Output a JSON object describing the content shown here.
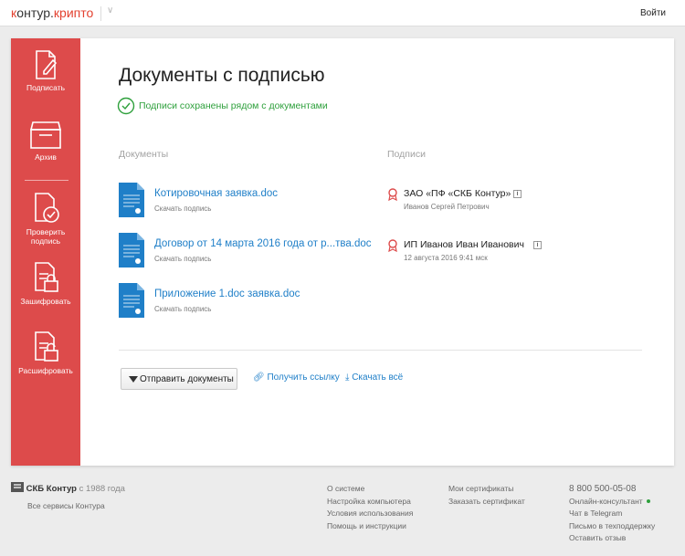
{
  "header": {
    "logo_k": "к",
    "logo_rest": "онтур.",
    "logo_product": "крипто",
    "login_label": "Войти"
  },
  "sidebar": {
    "items": [
      {
        "label": "Подписать",
        "icon": "sign-document-icon"
      },
      {
        "label": "Архив",
        "icon": "archive-icon"
      },
      {
        "label": "Проверить подпись",
        "icon": "verify-signature-icon"
      },
      {
        "label": "Зашифровать",
        "icon": "encrypt-icon"
      },
      {
        "label": "Расшифровать",
        "icon": "decrypt-icon"
      }
    ]
  },
  "main": {
    "title": "Документы с подписью",
    "success_message": "Подписи сохранены рядом с документами",
    "documents_header": "Документы",
    "signatures_header": "Подписи",
    "documents": [
      {
        "name": "Котировочная заявка.doc",
        "action": "Скачать подпись"
      },
      {
        "name": "Договор от 14 марта 2016 года от р...тва.doc",
        "action": "Скачать подпись"
      },
      {
        "name": "Приложение 1.doc заявка.doc",
        "action": "Скачать подпись"
      }
    ],
    "signatures": [
      {
        "name": "ЗАО «ПФ «СКБ Контур»",
        "detail": "Иванов Сергей Петрович"
      },
      {
        "name": "ИП Иванов Иван Иванович",
        "detail": "12 августа 2016  9:41 мск"
      }
    ],
    "actions": {
      "send_label": "Отправить документы",
      "get_link_label": "Получить ссылку",
      "download_all_label": "Скачать всё"
    }
  },
  "footer": {
    "brand": "СКБ Контур",
    "since": "с 1988 года",
    "all_services": "Все сервисы Контура",
    "col1": [
      "О системе",
      "Настройка компьютера",
      "Условия использования",
      "Помощь и инструкции"
    ],
    "col2": [
      "Мои сертификаты",
      "Заказать сертификат"
    ],
    "phone": "8 800 500-05-08",
    "col3": [
      "Онлайн-консультант",
      "Чат в Telegram",
      "Письмо в техподдержку",
      "Оставить отзыв"
    ]
  },
  "colors": {
    "accent": "#dd4b4b",
    "link": "#1f7fc8",
    "success": "#2ea03c"
  }
}
